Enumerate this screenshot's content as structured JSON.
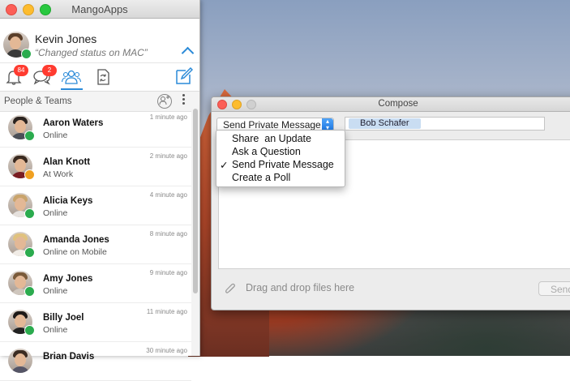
{
  "main_window": {
    "title": "MangoApps",
    "user": {
      "name": "Kevin Jones",
      "status": "“Changed status on MAC”"
    },
    "tabs": [
      {
        "icon": "bell-icon",
        "badge": "84"
      },
      {
        "icon": "chat-bubbles-icon",
        "badge": "2"
      },
      {
        "icon": "people-icon",
        "badge": ""
      },
      {
        "icon": "document-sync-icon",
        "badge": ""
      }
    ],
    "section_title": "People & Teams",
    "people": [
      {
        "name": "Aaron Waters",
        "status": "Online",
        "time": "1 minute ago"
      },
      {
        "name": "Alan Knott",
        "status": "At Work",
        "time": "2 minute ago"
      },
      {
        "name": "Alicia Keys",
        "status": "Online",
        "time": "4 minute ago"
      },
      {
        "name": "Amanda Jones",
        "status": "Online on Mobile",
        "time": "8 minute ago"
      },
      {
        "name": "Amy Jones",
        "status": "Online",
        "time": "9 minute ago"
      },
      {
        "name": "Billy Joel",
        "status": "Online",
        "time": "11 minute ago"
      },
      {
        "name": "Brian Davis",
        "status": "",
        "time": "30 minute ago"
      }
    ]
  },
  "compose": {
    "title": "Compose",
    "type_selected": "Send Private Message",
    "recipient": "Bob Schafer",
    "drop_hint": "Drag and drop files here",
    "send_label": "Send"
  },
  "menu": {
    "items": [
      {
        "label": "Share  an Update",
        "checked": false
      },
      {
        "label": "Ask a Question",
        "checked": false
      },
      {
        "label": "Send Private Message",
        "checked": true,
        "check_mark": "✓"
      },
      {
        "label": "Create a Poll",
        "checked": false
      }
    ]
  },
  "colors": {
    "accent": "#2a8ad8",
    "presence_online": "#2bab4e",
    "presence_away": "#f0a020",
    "presence_mobile": "#2bab4e",
    "badge": "#ff3b30"
  }
}
